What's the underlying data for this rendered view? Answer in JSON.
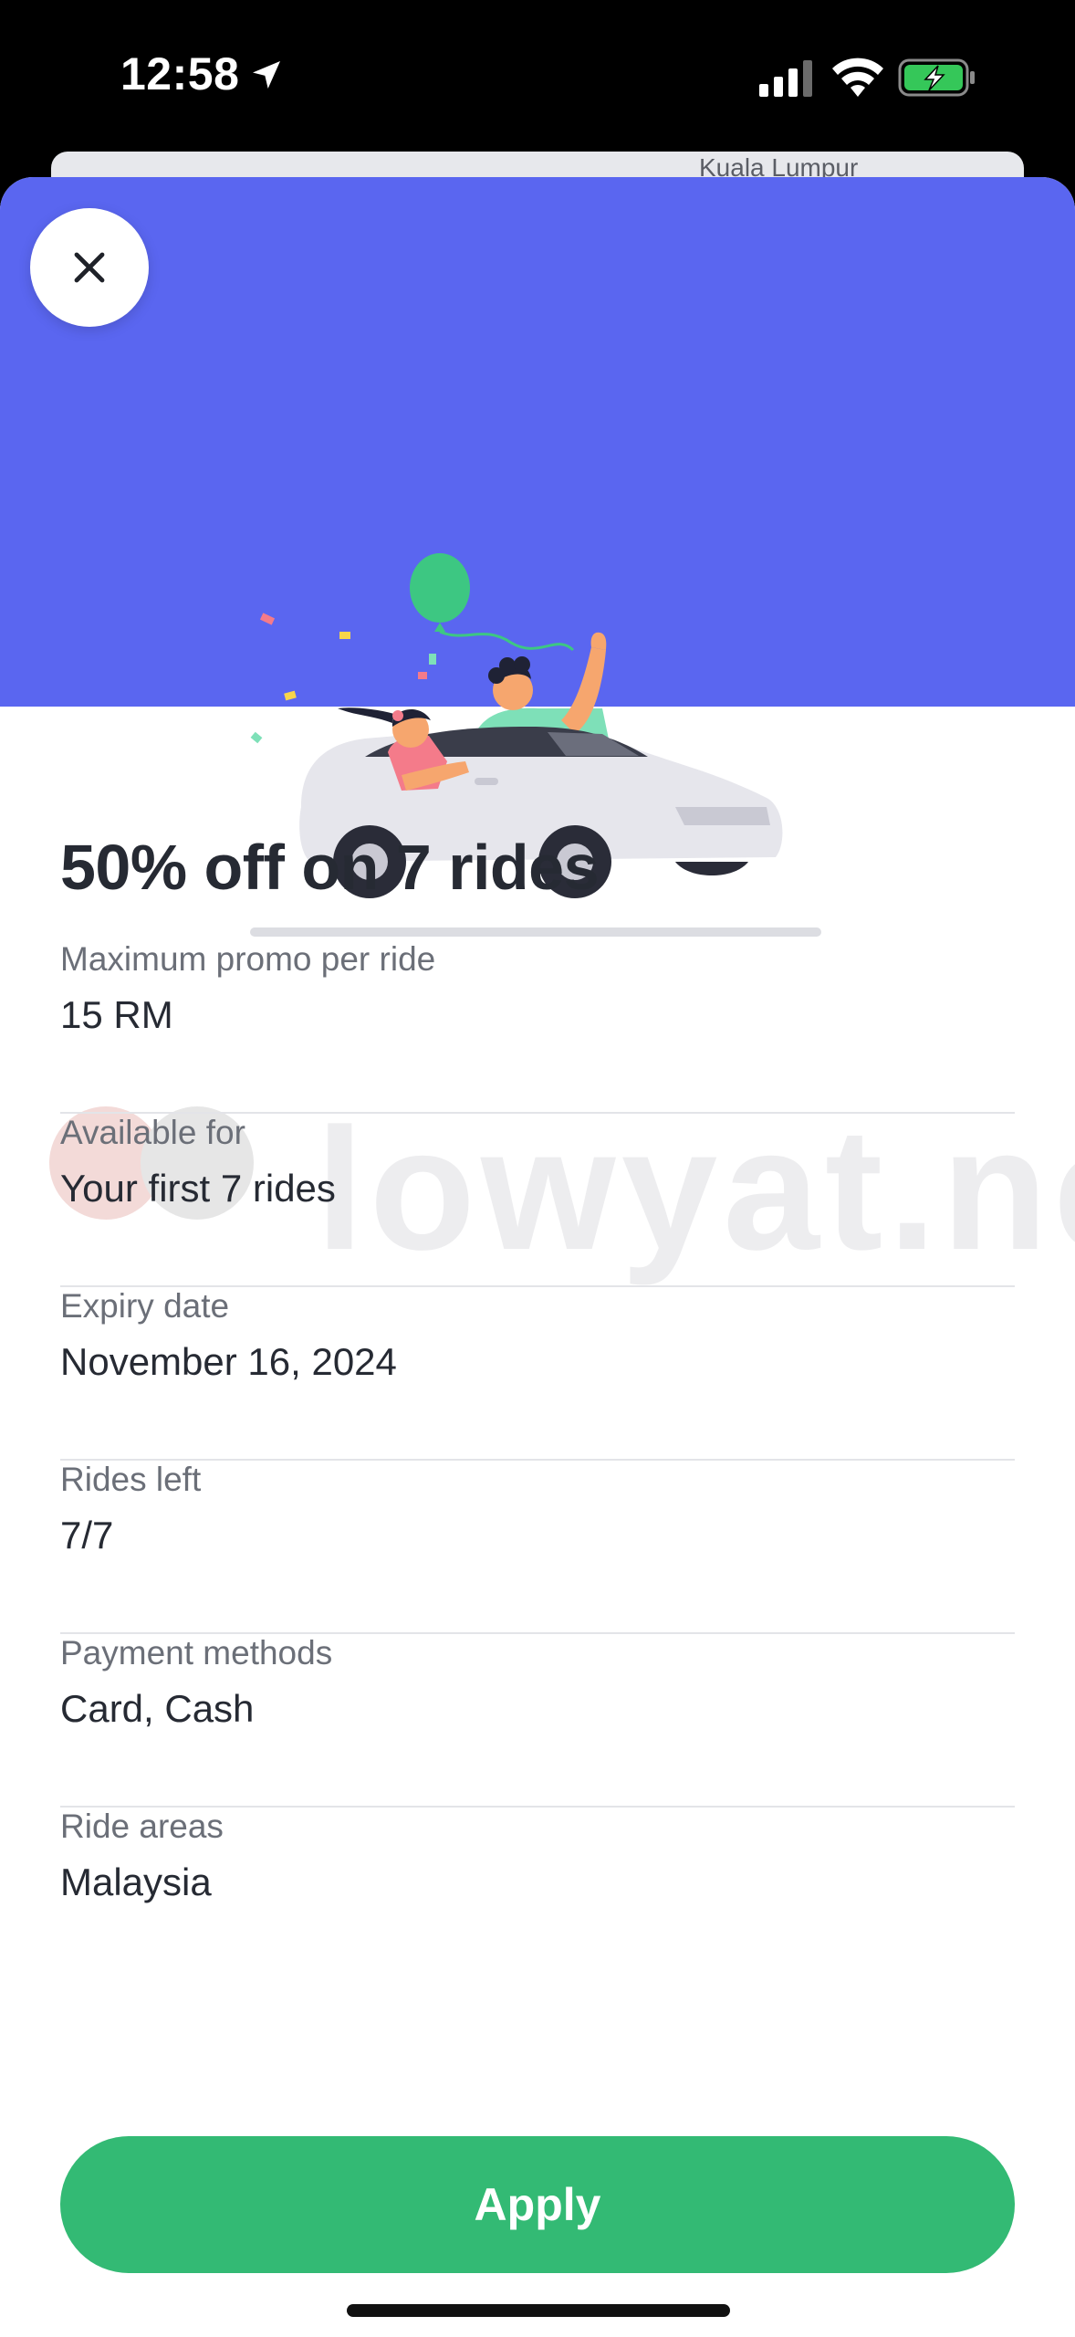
{
  "status_bar": {
    "time": "12:58"
  },
  "map": {
    "peek_label": "Kuala Lumpur"
  },
  "promo": {
    "title": "50% off on 7 rides",
    "details": [
      {
        "label": "Maximum promo per ride",
        "value": "15 RM"
      },
      {
        "label": "Available for",
        "value": "Your first 7 rides"
      },
      {
        "label": "Expiry date",
        "value": "November 16, 2024"
      },
      {
        "label": "Rides left",
        "value": "7/7"
      },
      {
        "label": "Payment methods",
        "value": "Card, Cash"
      },
      {
        "label": "Ride areas",
        "value": "Malaysia"
      }
    ],
    "apply_label": "Apply"
  },
  "watermark": {
    "text": "lowyat.net"
  },
  "colors": {
    "hero": "#5a66f0",
    "accent_green": "#33ba74",
    "title_text": "#262a33",
    "label_text": "#6b6f78"
  },
  "icons": {
    "close": "close-icon",
    "location": "location-arrow-icon",
    "signal": "cellular-signal-icon",
    "wifi": "wifi-icon",
    "battery": "battery-charging-icon"
  }
}
